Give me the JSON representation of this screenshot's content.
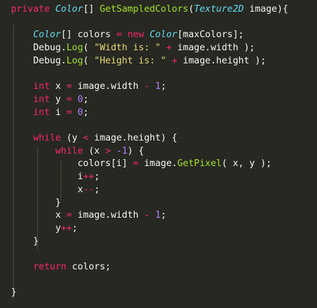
{
  "editor": {
    "lines": [
      [
        {
          "t": "private",
          "c": "kw"
        },
        {
          "t": " ",
          "c": "tx"
        },
        {
          "t": "Color",
          "c": "ty"
        },
        {
          "t": "[] ",
          "c": "tx"
        },
        {
          "t": "GetSampledColors",
          "c": "fn"
        },
        {
          "t": "(",
          "c": "tx"
        },
        {
          "t": "Texture2D",
          "c": "ty"
        },
        {
          "t": " image){",
          "c": "tx"
        }
      ],
      [],
      [
        {
          "t": "    ",
          "c": "tx"
        },
        {
          "t": "Color",
          "c": "ty"
        },
        {
          "t": "[] colors ",
          "c": "tx"
        },
        {
          "t": "=",
          "c": "op"
        },
        {
          "t": " ",
          "c": "tx"
        },
        {
          "t": "new",
          "c": "kw"
        },
        {
          "t": " ",
          "c": "tx"
        },
        {
          "t": "Color",
          "c": "ty"
        },
        {
          "t": "[maxColors];",
          "c": "tx"
        }
      ],
      [
        {
          "t": "    Debug.",
          "c": "tx"
        },
        {
          "t": "Log",
          "c": "fn"
        },
        {
          "t": "( ",
          "c": "tx"
        },
        {
          "t": "\"Width is: \"",
          "c": "st"
        },
        {
          "t": " ",
          "c": "tx"
        },
        {
          "t": "+",
          "c": "op"
        },
        {
          "t": " image.width );",
          "c": "tx"
        }
      ],
      [
        {
          "t": "    Debug.",
          "c": "tx"
        },
        {
          "t": "Log",
          "c": "fn"
        },
        {
          "t": "( ",
          "c": "tx"
        },
        {
          "t": "\"Height is: \"",
          "c": "st"
        },
        {
          "t": " ",
          "c": "tx"
        },
        {
          "t": "+",
          "c": "op"
        },
        {
          "t": " image.height );",
          "c": "tx"
        }
      ],
      [],
      [
        {
          "t": "    ",
          "c": "tx"
        },
        {
          "t": "int",
          "c": "kw"
        },
        {
          "t": " x ",
          "c": "tx"
        },
        {
          "t": "=",
          "c": "op"
        },
        {
          "t": " image.width ",
          "c": "tx"
        },
        {
          "t": "-",
          "c": "op"
        },
        {
          "t": " ",
          "c": "tx"
        },
        {
          "t": "1",
          "c": "nu"
        },
        {
          "t": ";",
          "c": "tx"
        }
      ],
      [
        {
          "t": "    ",
          "c": "tx"
        },
        {
          "t": "int",
          "c": "kw"
        },
        {
          "t": " y ",
          "c": "tx"
        },
        {
          "t": "=",
          "c": "op"
        },
        {
          "t": " ",
          "c": "tx"
        },
        {
          "t": "0",
          "c": "nu"
        },
        {
          "t": ";",
          "c": "tx"
        }
      ],
      [
        {
          "t": "    ",
          "c": "tx"
        },
        {
          "t": "int",
          "c": "kw"
        },
        {
          "t": " i ",
          "c": "tx"
        },
        {
          "t": "=",
          "c": "op"
        },
        {
          "t": " ",
          "c": "tx"
        },
        {
          "t": "0",
          "c": "nu"
        },
        {
          "t": ";",
          "c": "tx"
        }
      ],
      [],
      [
        {
          "t": "    ",
          "c": "tx"
        },
        {
          "t": "while",
          "c": "kw"
        },
        {
          "t": " (y ",
          "c": "tx"
        },
        {
          "t": "<",
          "c": "op"
        },
        {
          "t": " image.height) {",
          "c": "tx"
        }
      ],
      [
        {
          "t": "        ",
          "c": "tx"
        },
        {
          "t": "while",
          "c": "kw"
        },
        {
          "t": " (x ",
          "c": "tx"
        },
        {
          "t": ">",
          "c": "op"
        },
        {
          "t": " ",
          "c": "tx"
        },
        {
          "t": "-1",
          "c": "nu"
        },
        {
          "t": ") {",
          "c": "tx"
        }
      ],
      [
        {
          "t": "            colors[i] ",
          "c": "tx"
        },
        {
          "t": "=",
          "c": "op"
        },
        {
          "t": " image.",
          "c": "tx"
        },
        {
          "t": "GetPixel",
          "c": "fn"
        },
        {
          "t": "( x, y );",
          "c": "tx"
        }
      ],
      [
        {
          "t": "            i",
          "c": "tx"
        },
        {
          "t": "++",
          "c": "op"
        },
        {
          "t": ";",
          "c": "tx"
        }
      ],
      [
        {
          "t": "            x",
          "c": "tx"
        },
        {
          "t": "--",
          "c": "op"
        },
        {
          "t": ";",
          "c": "tx"
        }
      ],
      [
        {
          "t": "        }",
          "c": "tx"
        }
      ],
      [
        {
          "t": "        x ",
          "c": "tx"
        },
        {
          "t": "=",
          "c": "op"
        },
        {
          "t": " image.width ",
          "c": "tx"
        },
        {
          "t": "-",
          "c": "op"
        },
        {
          "t": " ",
          "c": "tx"
        },
        {
          "t": "1",
          "c": "nu"
        },
        {
          "t": ";",
          "c": "tx"
        }
      ],
      [
        {
          "t": "        y",
          "c": "tx"
        },
        {
          "t": "++",
          "c": "op"
        },
        {
          "t": ";",
          "c": "tx"
        }
      ],
      [
        {
          "t": "    }",
          "c": "tx"
        }
      ],
      [],
      [
        {
          "t": "    ",
          "c": "tx"
        },
        {
          "t": "return",
          "c": "kw"
        },
        {
          "t": " colors;",
          "c": "tx"
        }
      ],
      [],
      [
        {
          "t": "}",
          "c": "tx"
        }
      ]
    ]
  }
}
